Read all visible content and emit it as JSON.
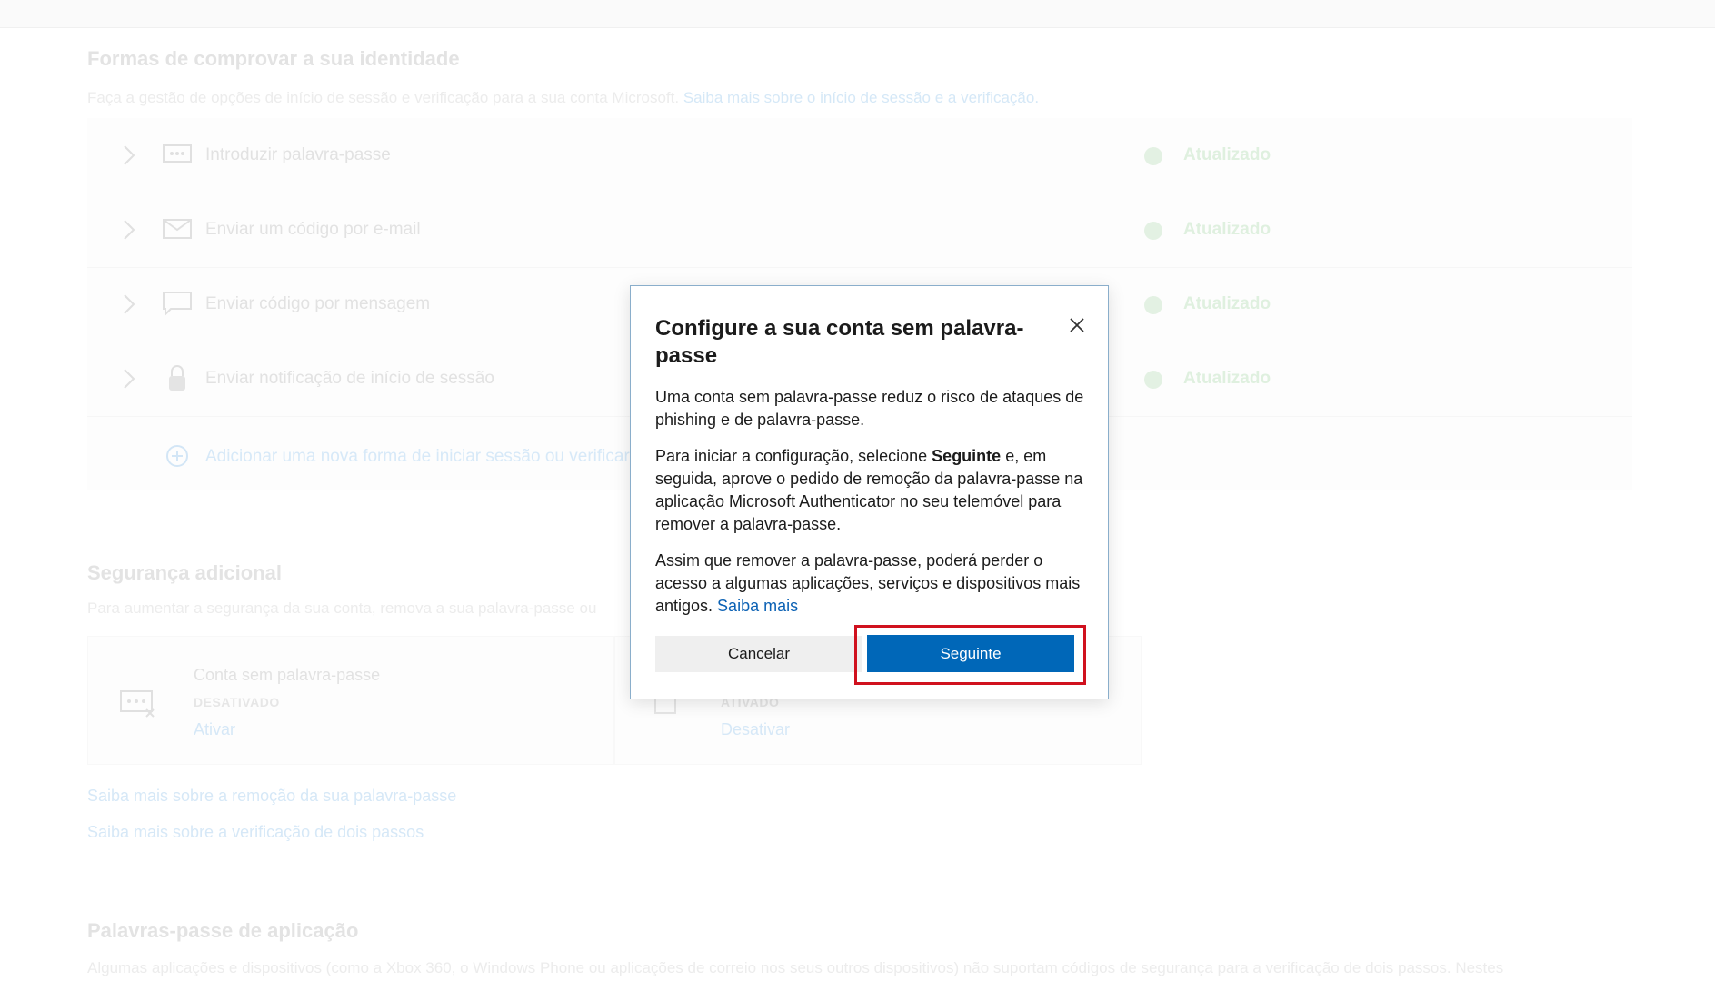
{
  "background": {
    "identity": {
      "title": "Formas de comprovar a sua identidade",
      "desc": "Faça a gestão de opções de início de sessão e verificação para a sua conta Microsoft.",
      "desc_link": "Saiba mais sobre o início de sessão e a verificação."
    },
    "methods": [
      {
        "label": "Introduzir palavra-passe",
        "status": "Atualizado",
        "icon": "password-icon"
      },
      {
        "label": "Enviar um código por e-mail",
        "status": "Atualizado",
        "icon": "mail-icon"
      },
      {
        "label": "Enviar código por mensagem",
        "status": "Atualizado",
        "icon": "message-icon"
      },
      {
        "label": "Enviar notificação de início de sessão",
        "status": "Atualizado",
        "icon": "lock-icon"
      }
    ],
    "add_method": "Adicionar uma nova forma de iniciar sessão ou verificar",
    "security": {
      "title": "Segurança adicional",
      "desc": "Para aumentar a segurança da sua conta, remova a sua palavra-passe ou"
    },
    "cards": [
      {
        "title": "Conta sem palavra-passe",
        "state": "DESATIVADO",
        "action": "Ativar"
      },
      {
        "title": "",
        "state": "ATIVADO",
        "action": "Desativar"
      }
    ],
    "links": [
      "Saiba mais sobre a remoção da sua palavra-passe",
      "Saiba mais sobre a verificação de dois passos"
    ],
    "app_passwords": {
      "title": "Palavras-passe de aplicação",
      "desc": "Algumas aplicações e dispositivos (como a Xbox 360, o Windows Phone ou aplicações de correio nos seus outros dispositivos) não suportam códigos de segurança para a verificação de dois passos. Nestes"
    }
  },
  "dialog": {
    "title": "Configure a sua conta sem palavra-passe",
    "p1": "Uma conta sem palavra-passe reduz o risco de ataques de phishing e de palavra-passe.",
    "p2_before": "Para iniciar a configuração, selecione ",
    "p2_bold": "Seguinte",
    "p2_after": " e, em seguida, aprove o pedido de remoção da palavra-passe na aplicação Microsoft Authenticator no seu telemóvel para remover a palavra-passe.",
    "p3": "Assim que remover a palavra-passe, poderá perder o acesso a algumas aplicações, serviços e dispositivos mais antigos. ",
    "p3_link": "Saiba mais",
    "cancel_label": "Cancelar",
    "next_label": "Seguinte",
    "close_icon": "close-icon"
  },
  "colors": {
    "primary_button": "#0067b8",
    "highlight": "#d0111e",
    "link": "#0b61b4"
  }
}
